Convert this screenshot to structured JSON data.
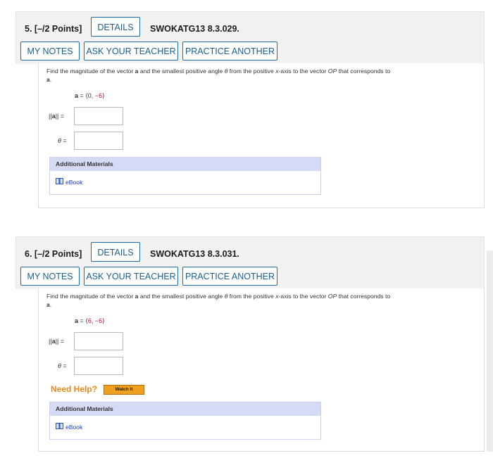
{
  "q5": {
    "number": "5.",
    "points": "[–/2 Points]",
    "details_label": "DETAILS",
    "code": "SWOKATG13 8.3.029.",
    "my_notes_label": "MY NOTES",
    "ask_teacher_label": "ASK YOUR TEACHER",
    "practice_label": "PRACTICE ANOTHER",
    "prompt_a": "Find the magnitude of the vector",
    "prompt_vec": "a",
    "prompt_b": "and the smallest positive angle",
    "prompt_theta": "θ",
    "prompt_c": "from the positive",
    "prompt_x": "x",
    "prompt_d": "-axis to the vector",
    "prompt_op": "OP",
    "prompt_e": "that corresponds to",
    "prompt_line2_vec": "a",
    "prompt_line2_end": ".",
    "eq_var": "a",
    "eq_mid": "= ⟨0, ",
    "eq_red": "−6",
    "eq_close": "⟩",
    "mag_label_open": "||",
    "mag_label_var": "a",
    "mag_label_close": "|| =",
    "theta_label": "θ =",
    "additional_materials": "Additional Materials",
    "ebook_label": "eBook"
  },
  "q6": {
    "number": "6.",
    "points": "[–/2 Points]",
    "details_label": "DETAILS",
    "code": "SWOKATG13 8.3.031.",
    "my_notes_label": "MY NOTES",
    "ask_teacher_label": "ASK YOUR TEACHER",
    "practice_label": "PRACTICE ANOTHER",
    "prompt_a": "Find the magnitude of the vector",
    "prompt_vec": "a",
    "prompt_b": "and the smallest positive angle",
    "prompt_theta": "θ",
    "prompt_c": "from the positive",
    "prompt_x": "x",
    "prompt_d": "-axis to the vector",
    "prompt_op": "OP",
    "prompt_e": "that corresponds to",
    "prompt_line2_vec": "a",
    "prompt_line2_end": ".",
    "eq_var": "a",
    "eq_mid": "= ⟨",
    "eq_red1": "6",
    "eq_sep": ", ",
    "eq_red2": "−6",
    "eq_close": "⟩",
    "mag_label_open": "||",
    "mag_label_var": "a",
    "mag_label_close": "|| =",
    "theta_label": "θ =",
    "need_help": "Need Help?",
    "watch_it": "Watch It",
    "additional_materials": "Additional Materials",
    "ebook_label": "eBook"
  },
  "colors": {
    "button_border": "#1c6ea4",
    "button_text": "#1c5d8c",
    "header_bg": "#f2f2f2",
    "highlight_red": "#d0021b",
    "need_help_orange": "#e68a1c",
    "watch_button": "#f0a020",
    "materials_header": "#d5dbf5",
    "ebook_link": "#1a3db0"
  },
  "icons": {
    "ebook": "book-icon"
  }
}
